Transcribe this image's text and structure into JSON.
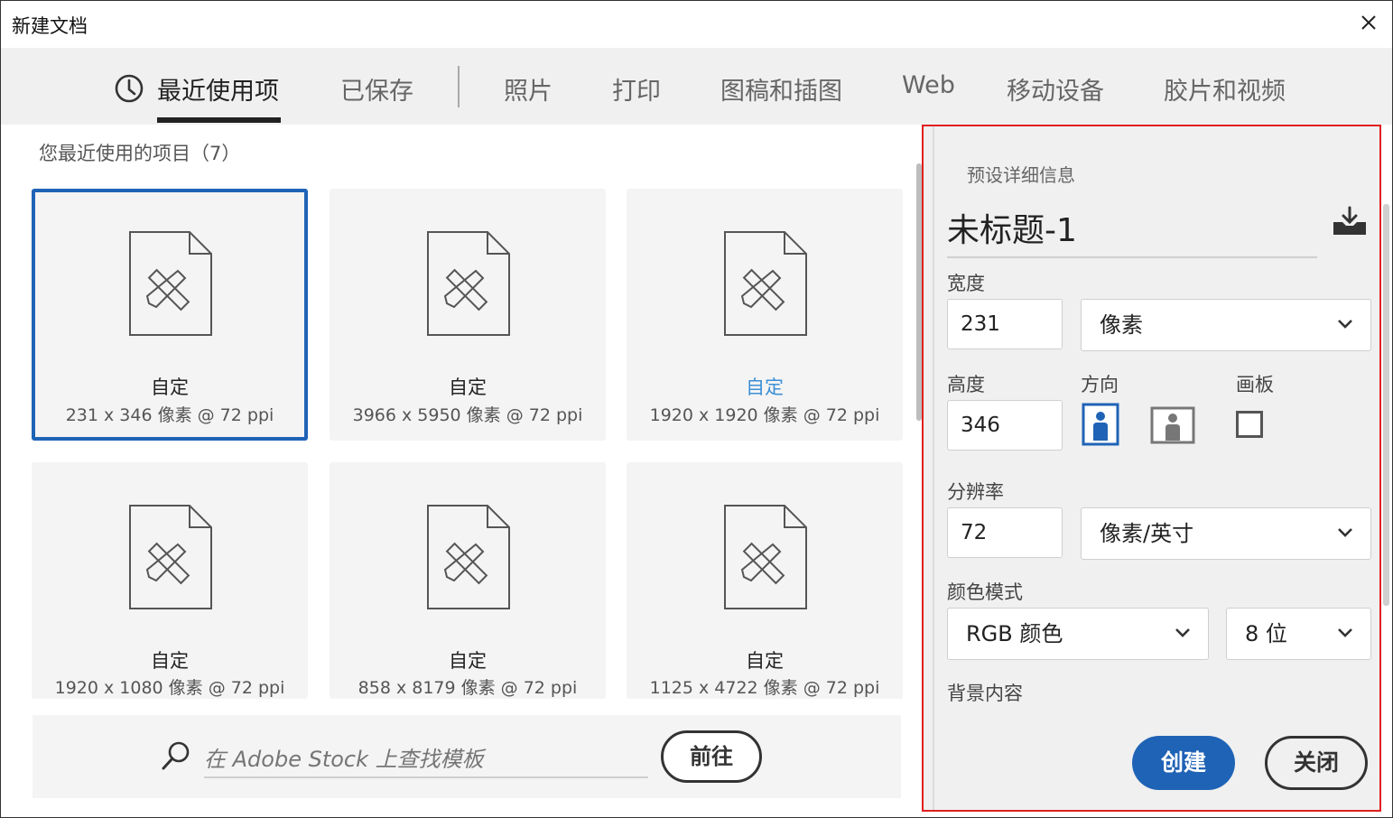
{
  "window": {
    "title": "新建文档"
  },
  "tabs": [
    {
      "label": "最近使用项"
    },
    {
      "label": "已保存"
    },
    {
      "label": "照片"
    },
    {
      "label": "打印"
    },
    {
      "label": "图稿和插图"
    },
    {
      "label": "Web"
    },
    {
      "label": "移动设备"
    },
    {
      "label": "胶片和视频"
    }
  ],
  "recent": {
    "label": "您最近使用的项目（7）",
    "items": [
      {
        "name": "自定",
        "meta": "231 x 346 像素 @ 72 ppi"
      },
      {
        "name": "自定",
        "meta": "3966 x 5950 像素 @ 72 ppi"
      },
      {
        "name": "自定",
        "meta": "1920 x 1920 像素 @ 72 ppi"
      },
      {
        "name": "自定",
        "meta": "1920 x 1080 像素 @ 72 ppi"
      },
      {
        "name": "自定",
        "meta": "858 x 8179 像素 @ 72 ppi"
      },
      {
        "name": "自定",
        "meta": "1125 x 4722 像素 @ 72 ppi"
      }
    ]
  },
  "stock": {
    "placeholder": "在 Adobe Stock 上查找模板",
    "go_label": "前往"
  },
  "preset": {
    "section_label": "预设详细信息",
    "doc_name": "未标题-1",
    "width_label": "宽度",
    "width_value": "231",
    "width_unit": "像素",
    "height_label": "高度",
    "height_value": "346",
    "orientation_label": "方向",
    "artboard_label": "画板",
    "resolution_label": "分辨率",
    "resolution_value": "72",
    "resolution_unit": "像素/英寸",
    "color_mode_label": "颜色模式",
    "color_mode": "RGB 颜色",
    "bit_depth": "8 位",
    "background_label": "背景内容",
    "create_label": "创建",
    "close_label": "关闭"
  },
  "colors": {
    "accent": "#1f63b6",
    "highlight_border": "#e02020",
    "name_highlight": "#3b8fd6"
  }
}
